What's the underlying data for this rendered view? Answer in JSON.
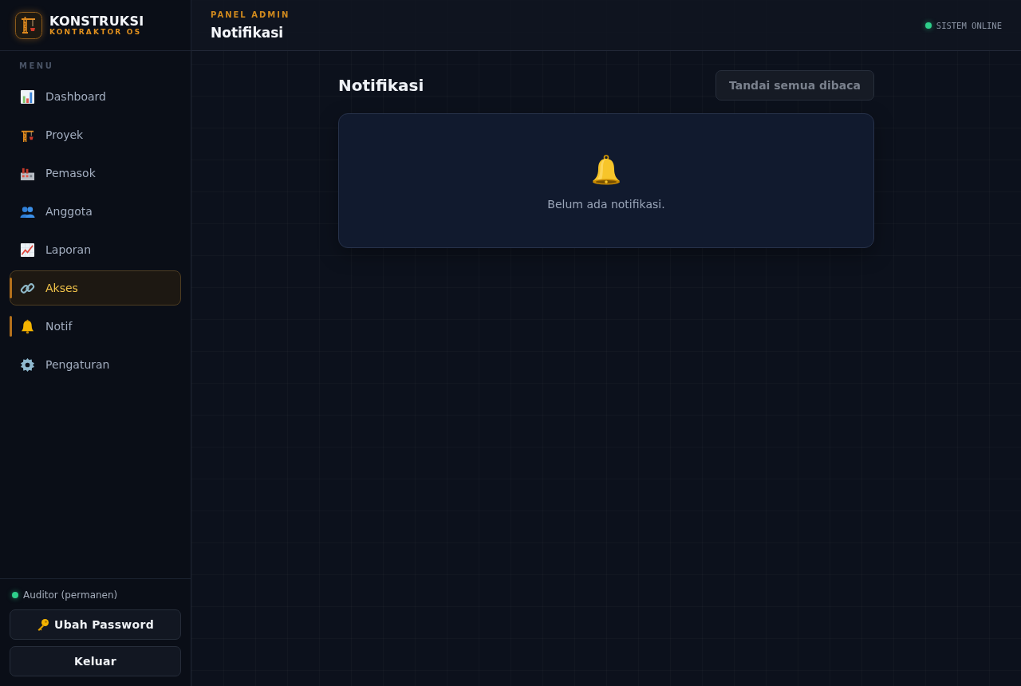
{
  "brand": {
    "name": "KONSTRUKSI",
    "tagline": "KONTRAKTOR OS"
  },
  "sidebar": {
    "section_label": "MENU",
    "items": [
      {
        "label": "Dashboard",
        "selected": false,
        "indicator": false
      },
      {
        "label": "Proyek",
        "selected": false,
        "indicator": false
      },
      {
        "label": "Pemasok",
        "selected": false,
        "indicator": false
      },
      {
        "label": "Anggota",
        "selected": false,
        "indicator": false
      },
      {
        "label": "Laporan",
        "selected": false,
        "indicator": false
      },
      {
        "label": "Akses",
        "selected": true,
        "indicator": true
      },
      {
        "label": "Notif",
        "selected": false,
        "indicator": true
      },
      {
        "label": "Pengaturan",
        "selected": false,
        "indicator": false
      }
    ],
    "footer": {
      "user": {
        "label": "Auditor (permanen)",
        "online": true
      },
      "buttons": [
        {
          "label": "Ubah Password",
          "kind": "icon"
        },
        {
          "label": "Keluar",
          "kind": "plain"
        }
      ]
    }
  },
  "header": {
    "eyebrow": "PANEL ADMIN",
    "title": "Notifikasi",
    "status": {
      "label": "SISTEM ONLINE",
      "online": true
    }
  },
  "content": {
    "title": "Notifikasi",
    "action": {
      "label": "Tandai semua dibaca",
      "disabled": true
    },
    "empty_state": {
      "message": "Belum ada notifikasi."
    }
  }
}
